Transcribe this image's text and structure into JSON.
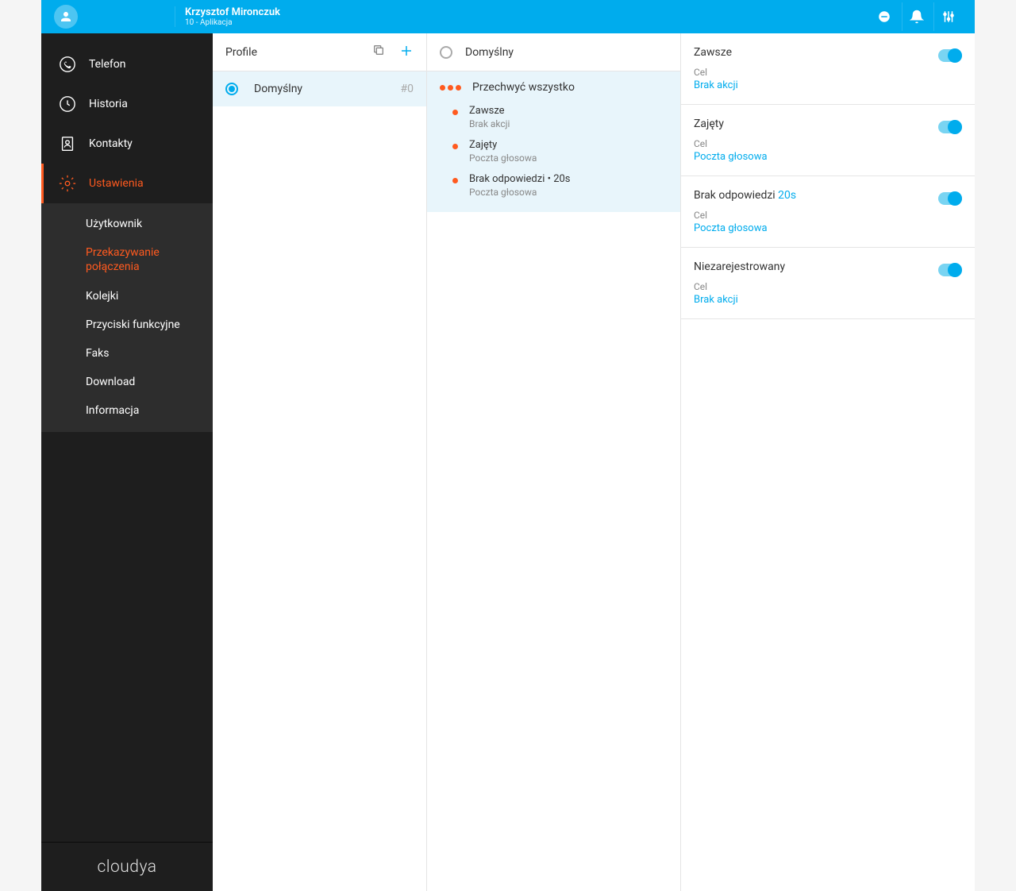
{
  "header": {
    "user_name": "Krzysztof Mironczuk",
    "user_sub": "10 - Aplikacja"
  },
  "nav": {
    "telefon": "Telefon",
    "historia": "Historia",
    "kontakty": "Kontakty",
    "ustawienia": "Ustawienia",
    "sub": {
      "uzytkownik": "Użytkownik",
      "przekazywanie": "Przekazywanie połączenia",
      "kolejki": "Kolejki",
      "przyciski": "Przyciski funkcyjne",
      "faks": "Faks",
      "download": "Download",
      "informacja": "Informacja"
    }
  },
  "brand": "cloudya",
  "profile": {
    "title": "Profile",
    "items": [
      {
        "name": "Domyślny",
        "id": "#0"
      }
    ]
  },
  "rules": {
    "header_title": "Domyślny",
    "main_rule": "Przechwyć wszystko",
    "sub_rules": [
      {
        "title": "Zawsze",
        "sub": "Brak akcji"
      },
      {
        "title": "Zajęty",
        "sub": "Poczta głosowa"
      },
      {
        "title": "Brak odpowiedzi • 20s",
        "sub": "Poczta głosowa"
      }
    ]
  },
  "details": {
    "cel_label": "Cel",
    "items": [
      {
        "title": "Zawsze",
        "accent": "",
        "value": "Brak akcji"
      },
      {
        "title": "Zajęty",
        "accent": "",
        "value": "Poczta głosowa"
      },
      {
        "title": "Brak odpowiedzi ",
        "accent": "20s",
        "value": "Poczta głosowa"
      },
      {
        "title": "Niezarejestrowany",
        "accent": "",
        "value": "Brak akcji"
      }
    ]
  }
}
